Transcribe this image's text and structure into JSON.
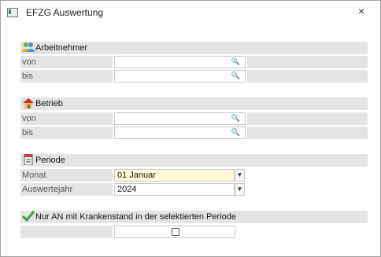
{
  "window": {
    "title": "EFZG Auswertung",
    "close_glyph": "×"
  },
  "arbeitnehmer": {
    "title": "Arbeitnehmer",
    "icon": "people-icon",
    "von_label": "von",
    "bis_label": "bis"
  },
  "betrieb": {
    "title": "Betrieb",
    "icon": "house-icon",
    "von_label": "von",
    "bis_label": "bis"
  },
  "periode": {
    "title": "Periode",
    "icon": "calendar-icon",
    "monat_label": "Monat",
    "monat_value": "01 Januar",
    "jahr_label": "Auswertejahr",
    "jahr_value": "2024"
  },
  "krankenstand": {
    "title": "Nur AN mit Krankenstand in der selektierten Periode",
    "icon": "checkmark-icon",
    "checked": false
  },
  "glyphs": {
    "search": "🔍",
    "dropdown": "▼"
  },
  "colors": {
    "section_bg": "#e4e4e4",
    "highlight": "#fffbd8"
  }
}
